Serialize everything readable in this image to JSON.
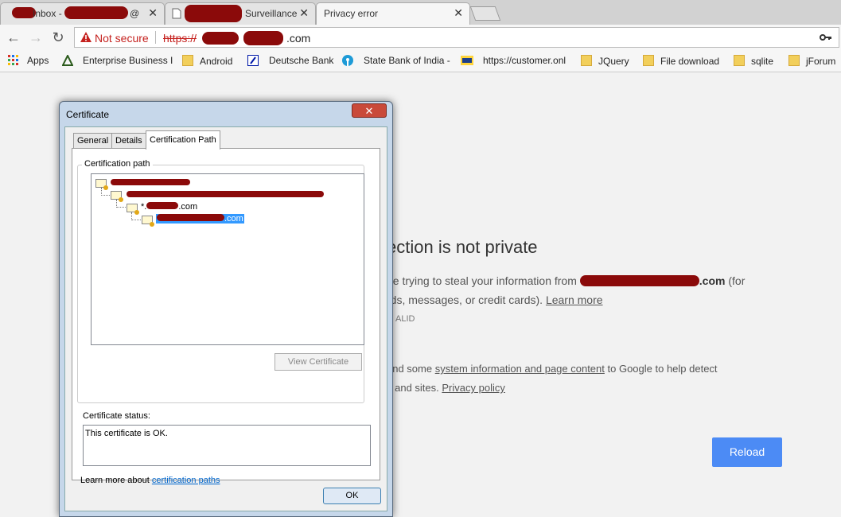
{
  "tabs": [
    {
      "title": "Inbox -",
      "partial": "@",
      "close": "✕",
      "active": false
    },
    {
      "title": "Surveillance",
      "close": "✕",
      "active": false
    },
    {
      "title": "Privacy error",
      "close": "✕",
      "active": true
    }
  ],
  "toolbar": {
    "back": "←",
    "forward": "→",
    "reload": "↻",
    "not_secure": "Not secure",
    "url_scheme": "https://",
    "url_rest": ".com"
  },
  "bookmarks": [
    {
      "label": "Apps",
      "icon": "apps-grid-icon"
    },
    {
      "label": "Enterprise Business I",
      "icon": "triangle-logo-icon"
    },
    {
      "label": "Android",
      "icon": "folder-icon"
    },
    {
      "label": "Deutsche Bank",
      "icon": "deutsche-bank-icon"
    },
    {
      "label": "State Bank of India -",
      "icon": "sbi-icon"
    },
    {
      "label": "https://customer.onl",
      "icon": "lic-icon"
    },
    {
      "label": "JQuery",
      "icon": "folder-icon"
    },
    {
      "label": "File download",
      "icon": "folder-icon"
    },
    {
      "label": "sqlite",
      "icon": "folder-icon"
    },
    {
      "label": "jForum",
      "icon": "folder-icon"
    }
  ],
  "interstitial": {
    "heading_partial": "ection is not private",
    "line1_prefix": "be trying to steal your information from ",
    "line1_domain": ".com",
    "line1_suffix": " (for",
    "line2_prefix": "rds, messages, or credit cards). ",
    "learn_more": "Learn more",
    "error_code_partial": "ALID",
    "report_line1_prefix": "end some ",
    "report_link": "system information and page content",
    "report_line1_suffix": " to Google to help detect",
    "report_line2_prefix": "s and sites. ",
    "privacy_policy": "Privacy policy",
    "reload": "Reload"
  },
  "dialog": {
    "title": "Certificate",
    "close": "✕",
    "tabs": [
      "General",
      "Details",
      "Certification Path"
    ],
    "active_tab": "Certification Path",
    "group_label": "Certification path",
    "tree": [
      {
        "label": ""
      },
      {
        "label": ""
      },
      {
        "label": "*.",
        "suffix": ".com"
      },
      {
        "label": ".com",
        "selected": true
      }
    ],
    "view_certificate": "View Certificate",
    "status_label": "Certificate status:",
    "status_text": "This certificate is OK.",
    "learn_more_prefix": "Learn more about ",
    "learn_more_link": "certification paths",
    "ok": "OK"
  },
  "colors": {
    "accent_blue": "#4c8bf5",
    "not_secure_red": "#c5221f",
    "redaction": "#8b0a0a",
    "selection": "#3399ff"
  }
}
